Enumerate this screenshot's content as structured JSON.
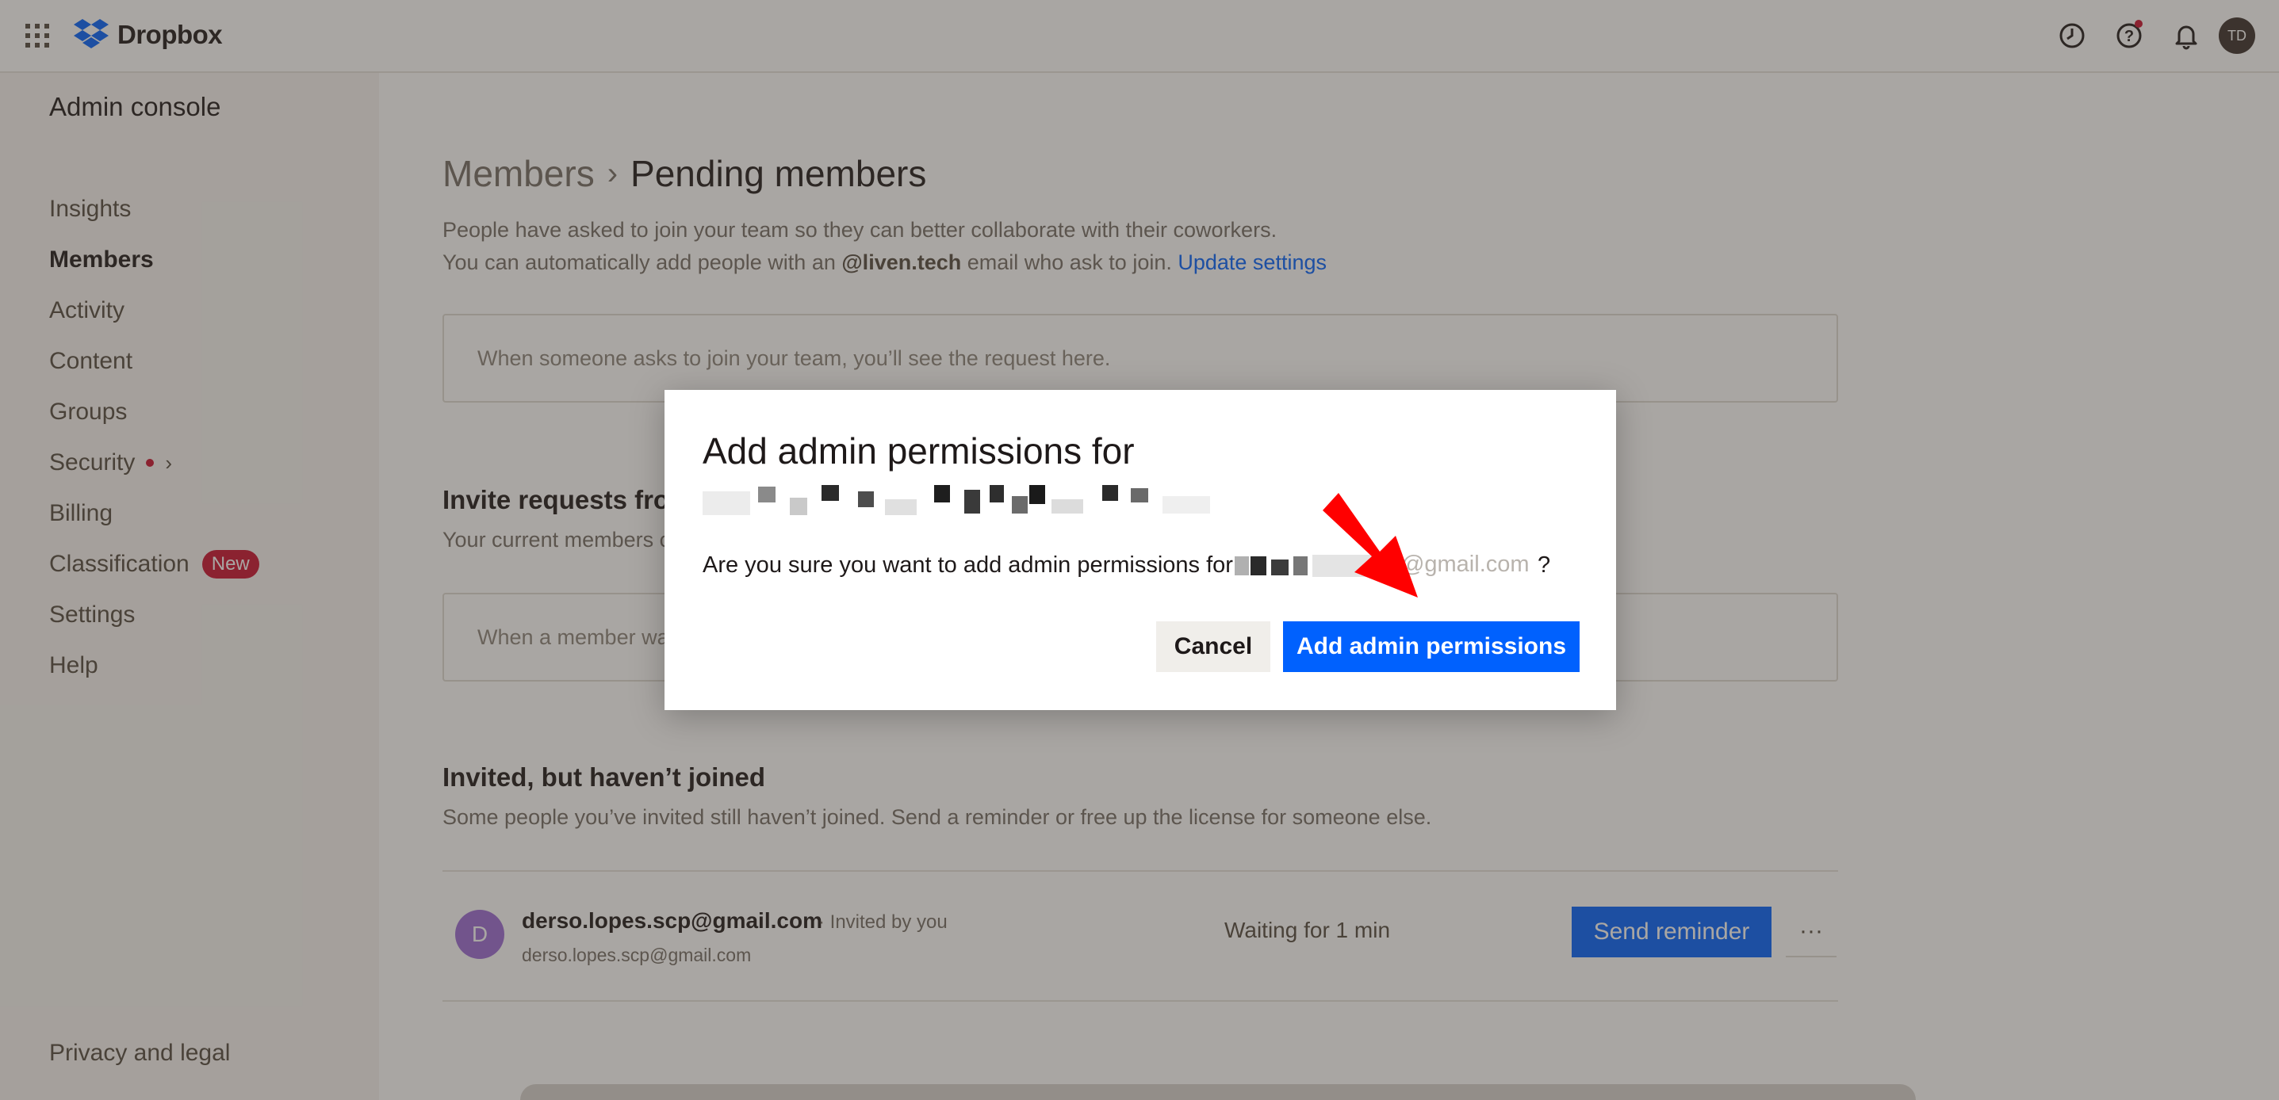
{
  "app": {
    "brand": "Dropbox",
    "avatar_initials": "TD"
  },
  "sidebar": {
    "title": "Admin console",
    "items": [
      {
        "label": "Insights"
      },
      {
        "label": "Members"
      },
      {
        "label": "Activity"
      },
      {
        "label": "Content"
      },
      {
        "label": "Groups"
      },
      {
        "label": "Security"
      },
      {
        "label": "Billing"
      },
      {
        "label": "Classification",
        "badge": "New"
      },
      {
        "label": "Settings"
      },
      {
        "label": "Help"
      }
    ],
    "footer": "Privacy and legal"
  },
  "main": {
    "breadcrumb_parent": "Members",
    "breadcrumb_sep": "›",
    "breadcrumb_current": "Pending members",
    "description_line1": "People have asked to join your team so they can better collaborate with their coworkers.",
    "description_line2_pre": "You can automatically add people with an ",
    "description_domain": "@liven.tech",
    "description_line2_post": " email who ask to join. ",
    "update_settings_link": "Update settings",
    "join_requests_empty": "When someone asks to join your team, you’ll see the request here.",
    "invite_requests_title": "Invite requests from members",
    "invite_requests_sub": "Your current members can request to invite people to join your team.",
    "invite_requests_empty": "When a member wants to invite someone, you’ll see the request here.",
    "invited_title": "Invited, but haven’t joined",
    "invited_sub": "Some people you’ve invited still haven’t joined. Send a reminder or free up the license for someone else.",
    "invited_rows": [
      {
        "avatar_letter": "D",
        "email": "derso.lopes.scp@gmail.com",
        "invited_by": "· Invited by you",
        "secondary": "derso.lopes.scp@gmail.com",
        "status": "Waiting for 1 min",
        "action": "Send reminder",
        "more": "···"
      }
    ]
  },
  "modal": {
    "title": "Add admin permissions for",
    "message_pre": "Are you sure you want to add admin permissions for ",
    "message_email_tail": "@gmail.com",
    "message_post": "?",
    "cancel_label": "Cancel",
    "confirm_label": "Add admin permissions"
  },
  "colors": {
    "accent": "#0061fe",
    "badge": "#c8102e",
    "annotation_arrow": "#ff0000"
  },
  "icons": [
    "apps-grid-icon",
    "dropbox-logo-icon",
    "clock-icon",
    "help-icon",
    "bell-icon"
  ]
}
